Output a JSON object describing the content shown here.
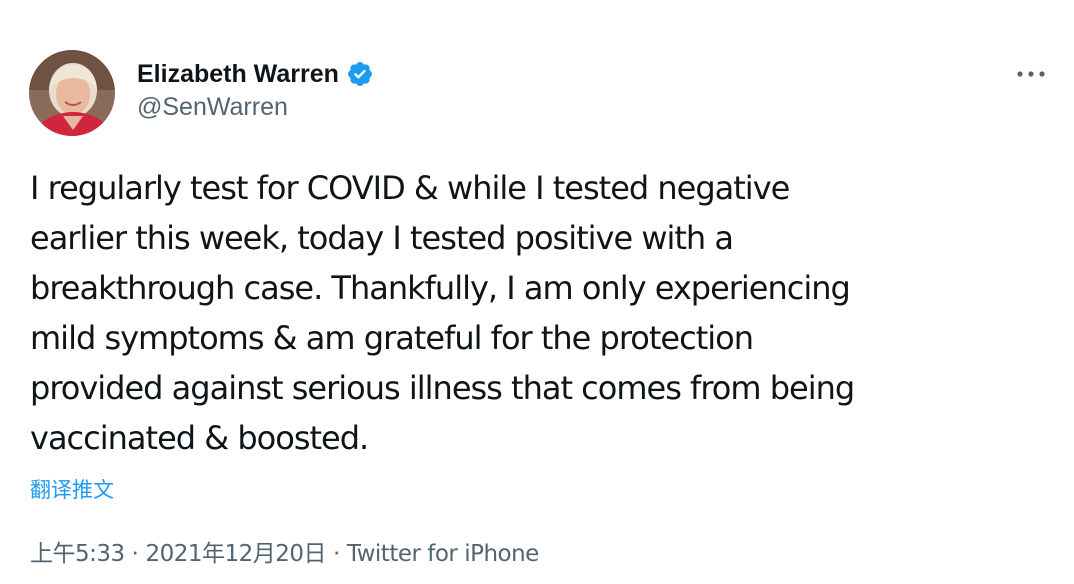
{
  "author": {
    "display_name": "Elizabeth Warren",
    "handle": "@SenWarren",
    "verified": true
  },
  "tweet": {
    "text": "I regularly test for COVID & while I tested negative\nearlier this week, today I tested positive with a\nbreakthrough case. Thankfully, I am only experiencing\nmild symptoms & am grateful for the protection\nprovided against serious illness that comes from being\nvaccinated & boosted.",
    "translate_label": "翻译推文",
    "time": "上午5:33",
    "date": "2021年12月20日",
    "source": "Twitter for iPhone",
    "separator": "·"
  },
  "icons": {
    "verified": "verified-badge-icon",
    "more": "more-horizontal-icon"
  },
  "colors": {
    "link": "#1d9bf0",
    "secondary_text": "#536471",
    "primary_text": "#0f1419"
  }
}
